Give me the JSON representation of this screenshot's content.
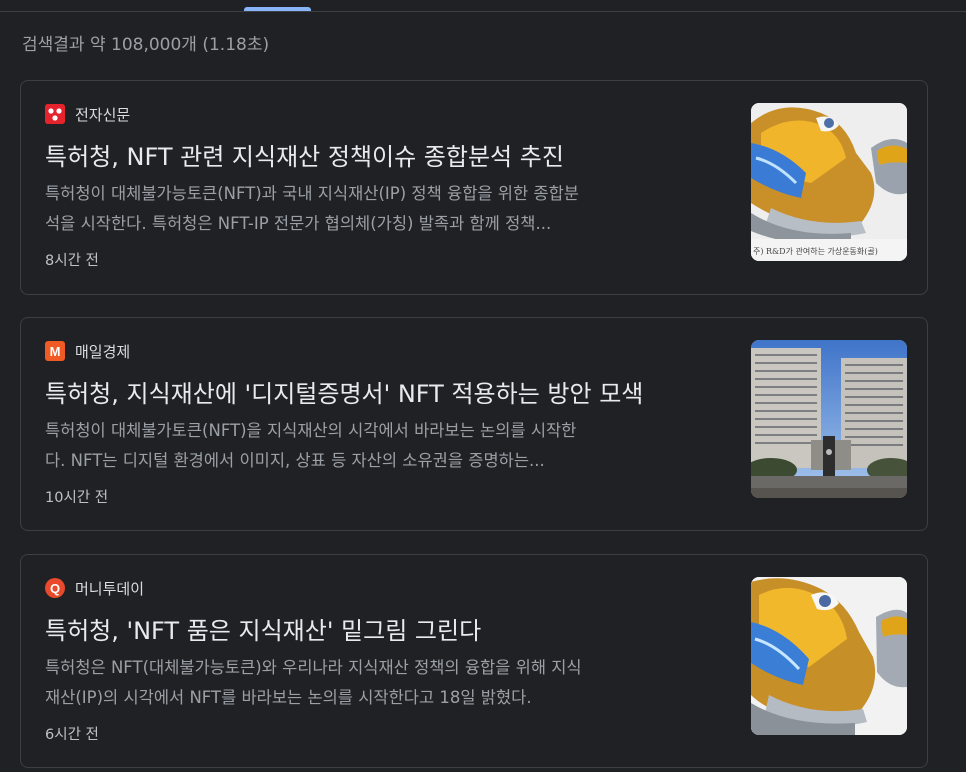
{
  "result_stats": "검색결과 약 108,000개 (1.18초)",
  "colors": {
    "background": "#202124",
    "accent": "#8ab4f8",
    "card_border": "#3c4043",
    "snippet": "#9aa0a6"
  },
  "results": [
    {
      "source": "전자신문",
      "favicon": "etnews-logo-icon",
      "headline": "특허청, NFT 관련 지식재산 정책이슈 종합분석 추진",
      "snippet_line1": "특허청이 대체불가능토큰(NFT)과 국내 지식재산(IP) 정책 융합을 위한 종합분",
      "snippet_line2": "석을 시작한다. 특허청은 NFT-IP 전문가 협의체(가칭) 발족과 함께 정책...",
      "time": "8시간 전",
      "thumbnail": "sneaker-image",
      "thumbnail_caption": "주) R&D가 관여하는 가상운동화(골)"
    },
    {
      "source": "매일경제",
      "favicon": "mk-logo-icon",
      "favicon_letter": "M",
      "headline": "특허청, 지식재산에 '디지털증명서' NFT 적용하는 방안 모색",
      "snippet_line1": "특허청이 대체불가토큰(NFT)을 지식재산의 시각에서 바라보는 논의를 시작한",
      "snippet_line2": "다. NFT는 디지털 환경에서 이미지, 상표 등 자산의 소유권을 증명하는...",
      "time": "10시간 전",
      "thumbnail": "government-building-image"
    },
    {
      "source": "머니투데이",
      "favicon": "mt-logo-icon",
      "favicon_letter": "Q",
      "headline": "특허청, 'NFT 품은 지식재산' 밑그림 그린다",
      "snippet_line1": "특허청은 NFT(대체불가능토큰)와 우리나라 지식재산 정책의 융합을 위해 지식",
      "snippet_line2": "재산(IP)의 시각에서 NFT를 바라보는 논의를 시작한다고 18일 밝혔다.",
      "time": "6시간 전",
      "thumbnail": "sneaker-image"
    }
  ]
}
